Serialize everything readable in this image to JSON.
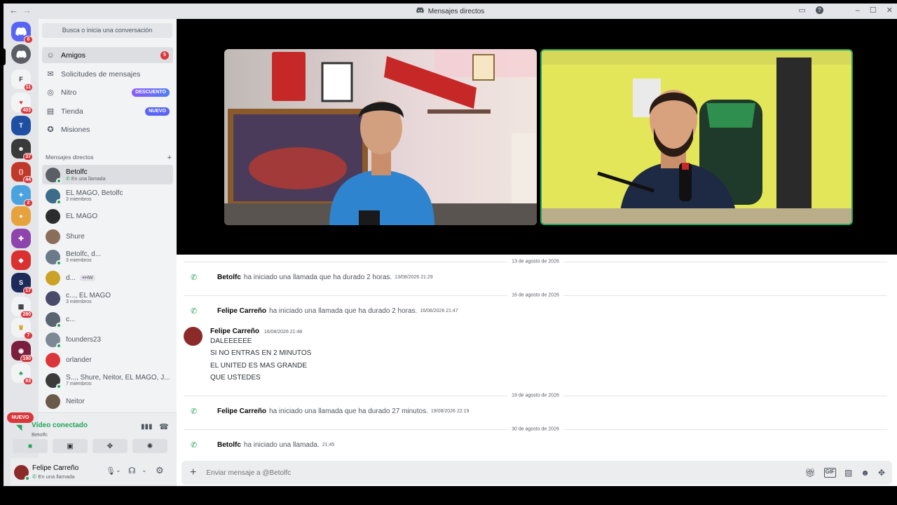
{
  "window": {
    "title": "Mensajes directos"
  },
  "guild_badges": [
    "6",
    "11",
    "403",
    "37",
    "44",
    "2",
    "17",
    "280",
    "7",
    "190",
    "83"
  ],
  "guild_nuevo": "NUEVO",
  "search": {
    "placeholder": "Busca o inicia una conversación"
  },
  "nav": {
    "amigos": {
      "label": "Amigos",
      "badge": "5"
    },
    "solicitudes": {
      "label": "Solicitudes de mensajes"
    },
    "nitro": {
      "label": "Nitro",
      "tag": "DESCUENTO"
    },
    "tienda": {
      "label": "Tienda",
      "tag": "NUEVO"
    },
    "misiones": {
      "label": "Misiones"
    }
  },
  "dm_header": "Mensajes directos",
  "dms": [
    {
      "name": "Betolfc",
      "sub": "En una llamada"
    },
    {
      "name": "EL MAGO, Betolfc",
      "sub": "3 miembros"
    },
    {
      "name": "EL MAGO",
      "sub": ""
    },
    {
      "name": "Shure",
      "sub": ""
    },
    {
      "name": "Betolfc, d...",
      "sub": "3 miembros"
    },
    {
      "name": "d...",
      "sub": "",
      "badge": "HW"
    },
    {
      "name": "c..., EL MAGO",
      "sub": "3 miembros"
    },
    {
      "name": "c...",
      "sub": ""
    },
    {
      "name": "founders23",
      "sub": ""
    },
    {
      "name": "orlander",
      "sub": ""
    },
    {
      "name": "S..., Shure, Neitor, EL MAGO, J...",
      "sub": "7 miembros"
    },
    {
      "name": "Neitor",
      "sub": ""
    }
  ],
  "voice": {
    "status": "Vídeo conectado",
    "channel": "Betolfc"
  },
  "user": {
    "name": "Felipe Carreño",
    "status": "En una llamada"
  },
  "messages": {
    "d1": "13 de agosto de 2026",
    "c1": {
      "author": "Betolfc",
      "text": "ha iniciado una llamada que ha durado 2 horas.",
      "ts": "13/08/2026 21:29"
    },
    "d2": "16 de agosto de 2026",
    "c2": {
      "author": "Felipe Carreño",
      "text": "ha iniciado una llamada que ha durado 2 horas.",
      "ts": "16/08/2026 21:47"
    },
    "m1": {
      "author": "Felipe Carreño",
      "ts": "16/08/2026 21:48",
      "lines": [
        "DALEEEEEE",
        "SI NO ENTRAS EN 2 MINUTOS",
        "EL UNITED ES MAS GRANDE",
        "QUE USTEDES"
      ]
    },
    "d3": "19 de agosto de 2026",
    "c3": {
      "author": "Felipe Carreño",
      "text": "ha iniciado una llamada que ha durado 27 minutos.",
      "ts": "19/08/2026 22:19"
    },
    "d4": "30 de agosto de 2026",
    "c4": {
      "author": "Betolfc",
      "text": "ha iniciado una llamada.",
      "ts": "21:45"
    }
  },
  "composer": {
    "placeholder": "Enviar mensaje a @Betolfc"
  },
  "colors": {
    "accent": "#5865f2",
    "green": "#23a55a",
    "red": "#da373c"
  }
}
